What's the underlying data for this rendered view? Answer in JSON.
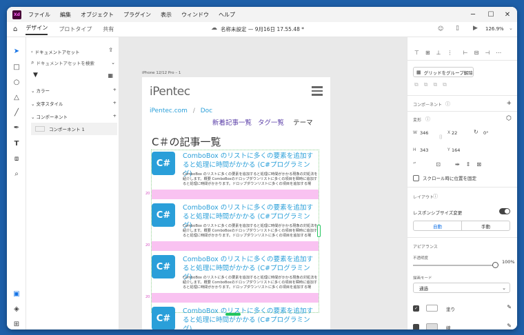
{
  "app": {
    "logo": "Xd",
    "menu": [
      "ファイル",
      "編集",
      "オブジェクト",
      "プラグイン",
      "表示",
      "ウィンドウ",
      "ヘルプ"
    ]
  },
  "tabs": [
    "デザイン",
    "プロトタイプ",
    "共有"
  ],
  "document": {
    "title": "名称未設定 — 9月16日 17.55.48 *",
    "zoom": "126.9%"
  },
  "assets": {
    "back": "ドキュメントアセット",
    "search_placeholder": "ドキュメントアセットを検索",
    "sections": [
      "カラー",
      "文字スタイル",
      "コンポーネント"
    ],
    "component": "コンポーネント 1"
  },
  "artboard": {
    "name": "iPhone 12/12 Pro – 1",
    "logo": "iPentec",
    "breadcrumb": [
      "iPentec.com",
      "/",
      "Doc"
    ],
    "nav": [
      "新着記事一覧",
      "タグ一覧",
      "テーマ"
    ],
    "heading": "C＃の記事一覧",
    "spacing": "20",
    "cards": [
      {
        "icon": "C#",
        "title": "ComboBox のリストに多くの要素を追加すると処理に時間がかかる (C#プログラミング)",
        "excerpt": "ComboBox のリストに多くの要素を追加すると処理に時間がかかる現象の対処法を紹介します。概要 ComboBoxのドロップダウンリストに多くの項目を瞬時に追加すると処理に時間がかかります。ドロップダウンリストに多くの項目を追加する場"
      },
      {
        "icon": "C#",
        "title": "ComboBox のリストに多くの要素を追加すると処理に時間がかかる (C#プログラミング)",
        "excerpt": "ComboBox のリストに多くの要素を追加すると処理に時間がかかる現象の対処法を紹介します。概要 ComboBoxのドロップダウンリストに多くの項目を瞬時に追加すると処理に時間がかかります。ドロップダウンリストに多くの項目を追加する場"
      },
      {
        "icon": "C#",
        "title": "ComboBox のリストに多くの要素を追加すると処理に時間がかかる (C#プログラミング)",
        "excerpt": "ComboBox のリストに多くの要素を追加すると処理に時間がかかる現象の対処法を紹介します。概要 ComboBoxのドロップダウンリストに多くの項目を瞬時に追加すると処理に時間がかかります。ドロップダウンリストに多くの項目を追加する場"
      },
      {
        "icon": "C#",
        "title": "ComboBox のリストに多くの要素を追加すると処理に時間がかかる (C#プログラミング)",
        "excerpt": ""
      }
    ]
  },
  "props": {
    "ungroup": "グリッドをグループ解除",
    "component": "コンポーネント",
    "transform": "変形",
    "W": "346",
    "X": "22",
    "rotation": "0°",
    "H": "343",
    "Y": "164",
    "fix_scroll": "スクロール時に位置を固定",
    "layout": "レイアウト",
    "responsive": "レスポンシブサイズ変更",
    "auto": "自動",
    "manual": "手動",
    "appearance": "アピアランス",
    "opacity_label": "不透明度",
    "opacity": "100%",
    "blend_label": "描画モード",
    "blend": "通過",
    "fill": "塗り",
    "stroke": "線"
  },
  "colors": {
    "accent": "#2a9fd9",
    "pink": "#f9c2f1",
    "selection": "#22c55e",
    "xd": "#470137"
  }
}
